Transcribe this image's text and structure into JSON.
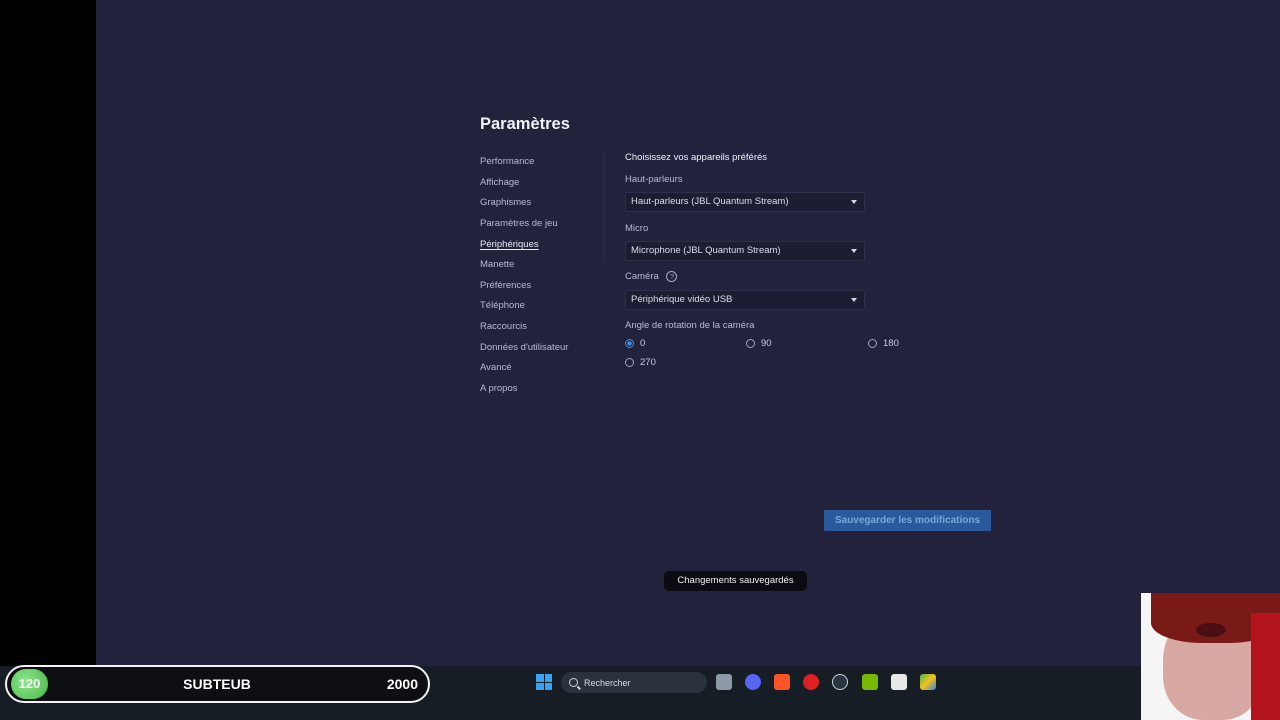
{
  "settings": {
    "title": "Paramètres",
    "nav": [
      {
        "label": "Performance",
        "active": false
      },
      {
        "label": "Affichage",
        "active": false
      },
      {
        "label": "Graphismes",
        "active": false
      },
      {
        "label": "Paramètres de jeu",
        "active": false
      },
      {
        "label": "Périphériques",
        "active": true
      },
      {
        "label": "Manette",
        "active": false
      },
      {
        "label": "Préférences",
        "active": false
      },
      {
        "label": "Téléphone",
        "active": false
      },
      {
        "label": "Raccourcis",
        "active": false
      },
      {
        "label": "Données d'utilisateur",
        "active": false
      },
      {
        "label": "Avancé",
        "active": false
      },
      {
        "label": "A propos",
        "active": false
      }
    ],
    "devices": {
      "section_title": "Choisissez vos appareils préférés",
      "speakers_label": "Haut-parleurs",
      "speakers_value": "Haut-parleurs (JBL Quantum Stream)",
      "mic_label": "Micro",
      "mic_value": "Microphone (JBL Quantum Stream)",
      "camera_label": "Caméra",
      "camera_help": "?",
      "camera_value": "Périphérique vidéo USB",
      "rotation_label": "Angle de rotation de la caméra",
      "rotation_options": [
        "0",
        "90",
        "180",
        "270"
      ],
      "rotation_selected": "0"
    },
    "save_label": "Sauvegarder les modifications",
    "toast": "Changements sauvegardés"
  },
  "overlay": {
    "level": "120",
    "name": "SUBTEUB",
    "target": "2000"
  },
  "taskbar": {
    "search_placeholder": "Rechercher",
    "apps": [
      "file-explorer-icon",
      "discord-icon",
      "brave-icon",
      "youtube-icon",
      "steam-icon",
      "nvidia-icon",
      "calendar-icon",
      "bluestacks-icon"
    ]
  },
  "colors": {
    "app_bg": "#22223c",
    "accent": "#3d8eea",
    "save_button": "#2a5a9c"
  }
}
